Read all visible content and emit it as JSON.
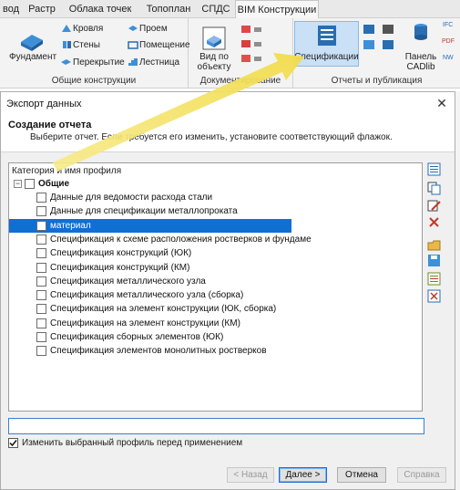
{
  "ribbon": {
    "tabs": [
      "вод",
      "Растр",
      "Облака точек",
      "Топоплан",
      "СПДС",
      "BIM Конструкции"
    ],
    "active_tab": "BIM Конструкции",
    "general": {
      "title": "Общие конструкции",
      "foundation": "Фундамент",
      "roof": "Кровля",
      "walls": "Стены",
      "slab": "Перекрытие",
      "opening": "Проем",
      "room": "Помещение",
      "stairs": "Лестница"
    },
    "docs": {
      "title": "Документирование",
      "view_line1": "Вид по",
      "view_line2": "объекту"
    },
    "reports": {
      "title": "Отчеты и публикация",
      "spec": "Спецификации",
      "cad_line1": "Панель",
      "cad_line2": "CADlib",
      "ifc": "IFC",
      "pdf": "PDF",
      "nw": "NW"
    }
  },
  "dialog": {
    "title": "Экспорт данных",
    "close": "✕",
    "header_title": "Создание отчета",
    "header_subtitle": "Выберите отчет. Если требуется его изменить, установите соответствующий флажок.",
    "list_header": "Категория и имя профиля",
    "group": "Общие",
    "expander": "−",
    "items": [
      "Данные для ведомости расхода стали",
      "Данные для спецификации металлопроката",
      "материал",
      "Спецификация к схеме расположения ростверков и фундаме",
      "Спецификация конструкций (ЮК)",
      "Спецификация конструкций (КМ)",
      "Спецификация металлического узла",
      "Спецификация металлического узла (сборка)",
      "Спецификация на элемент конструкции (ЮК, сборка)",
      "Спецификация на элемент конструкции (КМ)",
      "Спецификация сборных элементов (ЮК)",
      "Спецификация элементов монолитных ростверков"
    ],
    "selected_item": "материал",
    "name_value": "",
    "option_label": "Изменить выбранный профиль перед применением",
    "option_checked": true,
    "buttons": {
      "back": "< Назад",
      "next": "Далее >",
      "cancel": "Отмена",
      "help": "Справка"
    }
  },
  "colors": {
    "selection": "#0f6fd2",
    "arrow": "#f5e26a",
    "accent": "#1a6dd6"
  }
}
